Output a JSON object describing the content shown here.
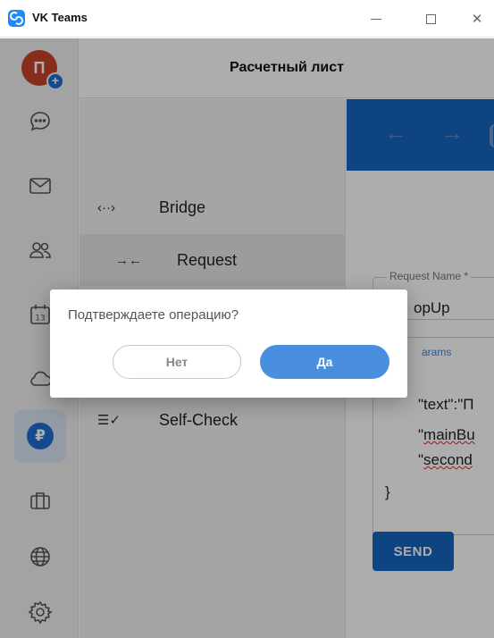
{
  "window": {
    "app_title": "VK Teams"
  },
  "rail": {
    "avatar_initial": "П",
    "avatar_add": "+",
    "items": [
      {
        "icon": "chat-bubble-icon"
      },
      {
        "icon": "mail-icon"
      },
      {
        "icon": "contacts-icon"
      },
      {
        "icon": "calendar-icon",
        "day": "13"
      },
      {
        "icon": "cloud-icon"
      },
      {
        "icon": "ruble-icon",
        "glyph": "₽",
        "active": true
      },
      {
        "icon": "briefcase-icon"
      },
      {
        "icon": "globe-icon"
      },
      {
        "icon": "settings-gear-icon"
      }
    ]
  },
  "header": {
    "title": "Расчетный лист"
  },
  "nav": {
    "items": [
      {
        "icon": "‹··›",
        "label": "Bridge"
      },
      {
        "icon": "→←",
        "label": "Request",
        "active": true
      },
      {
        "icon": "☰✓",
        "label": "Self-Check"
      }
    ]
  },
  "content": {
    "back_arrow": "←",
    "forward_arrow": "→",
    "request_name_label": "Request Name *",
    "request_name_value": "opUp",
    "params_label": "arams",
    "code_lines": [
      {
        "pre": "\"text\":\"П",
        "squig": ""
      },
      {
        "pre": "\"",
        "squig": "mainBu"
      },
      {
        "pre": "\"",
        "squig": "second"
      },
      {
        "pre": "}",
        "squig": ""
      }
    ],
    "send_label": "SEND"
  },
  "dialog": {
    "message": "Подтверждаете операцию?",
    "no_label": "Нет",
    "yes_label": "Да"
  },
  "colors": {
    "accent": "#1565c0",
    "confirm": "#4a8fdf",
    "avatar": "#c8432a"
  }
}
